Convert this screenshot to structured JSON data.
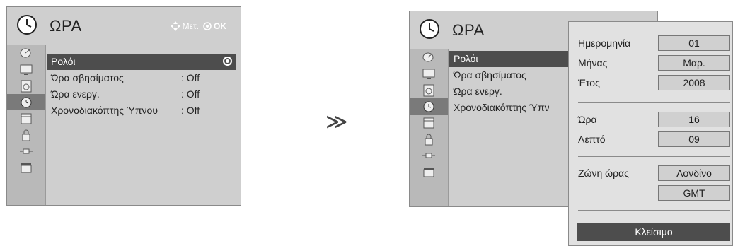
{
  "left_menu": {
    "title": "ΩΡΑ",
    "hint_move": "Μετ.",
    "hint_ok": "OK",
    "items": [
      {
        "label": "Ρολόι",
        "value": ""
      },
      {
        "label": "Ώρα σβησίματος",
        "value": ": Off"
      },
      {
        "label": "Ώρα ενεργ.",
        "value": ": Off"
      },
      {
        "label": "Χρονοδιακόπτης Ύπνου",
        "value": ": Off"
      }
    ]
  },
  "arrow": "≫",
  "right_menu": {
    "title": "ΩΡΑ",
    "items": [
      {
        "label": "Ρολόι"
      },
      {
        "label": "Ώρα σβησίματος"
      },
      {
        "label": "Ώρα ενεργ."
      },
      {
        "label": "Χρονοδιακόπτης Ύπν"
      }
    ]
  },
  "clock_popup": {
    "rows": [
      {
        "label": "Ημερομηνία",
        "value": "01"
      },
      {
        "label": "Μήνας",
        "value": "Μαρ."
      },
      {
        "label": "Έτος",
        "value": "2008"
      },
      {
        "label": "Ώρα",
        "value": "16"
      },
      {
        "label": "Λεπτό",
        "value": "09"
      },
      {
        "label": "Ζώνη ώρας",
        "value": "Λονδίνο"
      },
      {
        "label": "",
        "value": "GMT"
      }
    ],
    "close_label": "Κλείσιμο"
  },
  "colors": {
    "panel_bg": "#cfcfcf",
    "sidebar_bg": "#b9b9b9",
    "selected_bg": "#4d4d4d",
    "popup_bg": "#e1e1e1"
  },
  "sidebar_icons": [
    "satellite-dish-icon",
    "tv-screen-icon",
    "speaker-icon",
    "clock-icon",
    "calendar-icon",
    "lock-icon",
    "plug-icon",
    "clapperboard-icon"
  ]
}
